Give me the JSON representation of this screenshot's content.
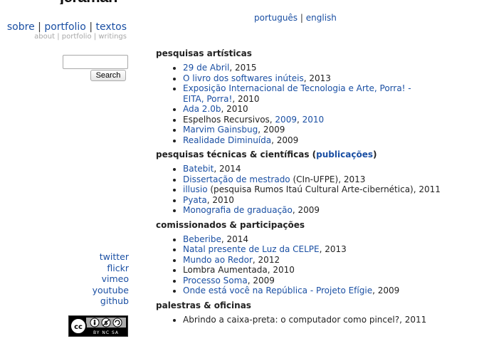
{
  "site": {
    "logo": "jeraman"
  },
  "nav": {
    "main": [
      "sobre",
      "portfolio",
      "textos"
    ],
    "sep": "|",
    "sub": [
      "about",
      "portfolio",
      "writings"
    ]
  },
  "lang": {
    "pt": "português",
    "en": "english",
    "sep": "|"
  },
  "search": {
    "value": "",
    "button": "Search"
  },
  "social": [
    "twitter",
    "flickr",
    "vimeo",
    "youtube",
    "github"
  ],
  "license": {
    "icon": "creative-commons-by-nc-sa-icon",
    "text": "BY NC SA"
  },
  "sections": {
    "s1": {
      "title": "pesquisas artísticas",
      "items": [
        {
          "link": "29 de Abril",
          "rest": ", 2015"
        },
        {
          "link": " O livro dos softwares inúteis",
          "rest": ", 2013"
        },
        {
          "link": "Exposição Internacional de Tecnologia e Arte, Porra! - EITA,",
          "rest": ""
        },
        {
          "link": "Porra!",
          "rest": ", 2010"
        },
        {
          "link": "Ada 2.0b",
          "rest": ", 2010"
        },
        {
          "pre": "Espelhos Recursivos, ",
          "link": "2009",
          "sep": ", ",
          "link2": "2010"
        },
        {
          "link": "Marvim Gainsbug",
          "rest": ", 2009"
        },
        {
          "link": "Realidade Diminuída",
          "rest": ", 2009"
        }
      ]
    },
    "s2": {
      "title_pre": "pesquisas técnicas & científicas (",
      "title_link": "publicações",
      "title_post": ")",
      "items": [
        {
          "link": "Batebit",
          "rest": ", 2014"
        },
        {
          "link": "Dissertação de mestrado",
          "rest": " (CIn-UFPE), 2013"
        },
        {
          "link": "illusio",
          "rest": " (pesquisa Rumos Itaú Cultural Arte-cibernética), 2011"
        },
        {
          "link": "Pyata",
          "rest": ", 2010"
        },
        {
          "link": "Monografia de graduação",
          "rest": ", 2009"
        }
      ]
    },
    "s3": {
      "title": "comissionados & participações",
      "items": [
        {
          "link": "Beberibe",
          "rest": ", 2014"
        },
        {
          "link": "Natal presente de Luz da CELPE",
          "rest": ", 2013"
        },
        {
          "link": "Mundo ao Redor",
          "rest": ", 2012"
        },
        {
          "plain": "Lombra Aumentada, 2010"
        },
        {
          "link": "Processo Soma",
          "rest": ", 2009"
        },
        {
          "link": "Onde está você na República - Projeto Efígie",
          "rest": ", 2009"
        }
      ]
    },
    "s4": {
      "title": "palestras & oficinas",
      "items": [
        {
          "plain": "Abrindo a caixa-preta: o computador como pincel?, 2011"
        }
      ]
    }
  }
}
